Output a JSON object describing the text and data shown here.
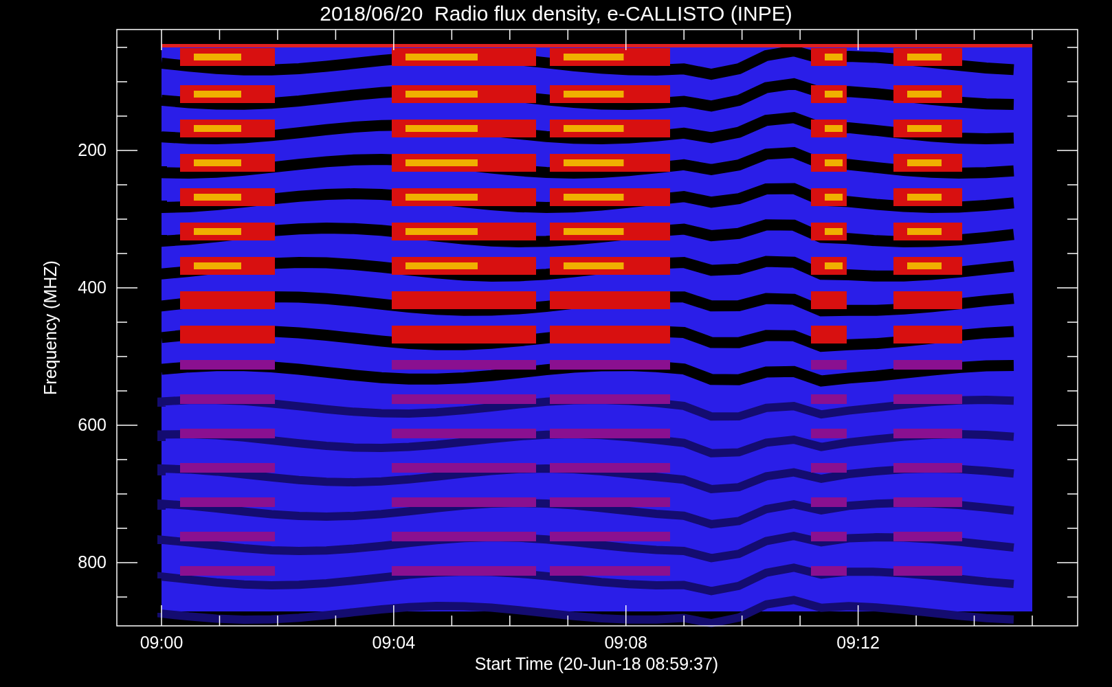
{
  "title": "2018/06/20  Radio flux density, e-CALLISTO (INPE)",
  "y_axis": {
    "label": "Frequency (MHZ)",
    "ticks": [
      "200",
      "400",
      "600",
      "800"
    ]
  },
  "x_axis": {
    "label": "Start Time (20-Jun-18 08:59:37)",
    "ticks": [
      "09:00",
      "09:04",
      "09:08",
      "09:12"
    ]
  }
}
